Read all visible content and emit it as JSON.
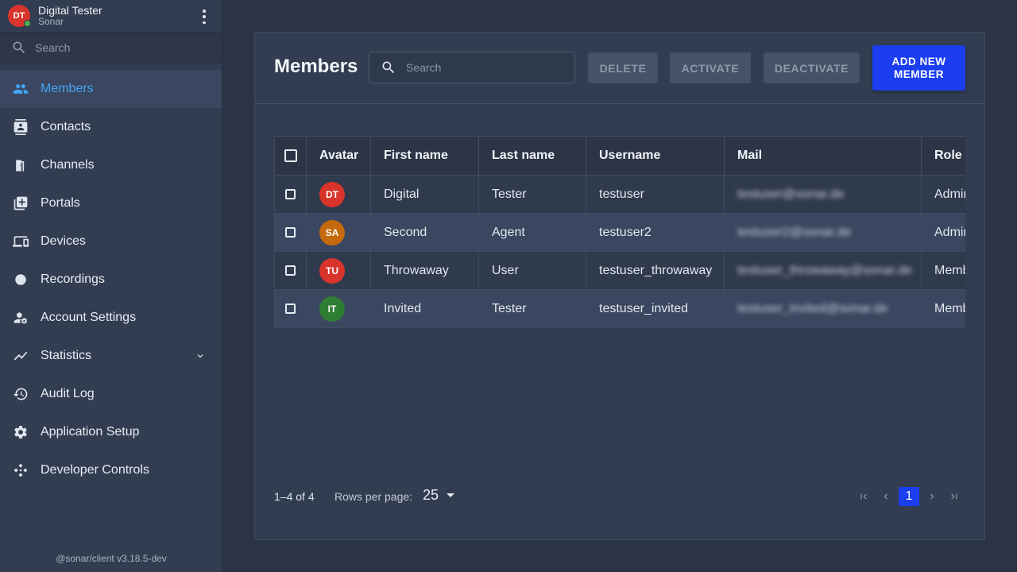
{
  "user": {
    "initials": "DT",
    "name": "Digital Tester",
    "org": "Sonar",
    "avatar_color": "#d9342b",
    "status_color": "#4caf50"
  },
  "sidebar": {
    "search_placeholder": "Search",
    "items": [
      {
        "label": "Members",
        "icon": "members-icon",
        "active": true
      },
      {
        "label": "Contacts",
        "icon": "contacts-icon"
      },
      {
        "label": "Channels",
        "icon": "channels-icon"
      },
      {
        "label": "Portals",
        "icon": "portals-icon"
      },
      {
        "label": "Devices",
        "icon": "devices-icon"
      },
      {
        "label": "Recordings",
        "icon": "recordings-icon"
      },
      {
        "label": "Account Settings",
        "icon": "account-settings-icon"
      },
      {
        "label": "Statistics",
        "icon": "statistics-icon",
        "expandable": true
      },
      {
        "label": "Audit Log",
        "icon": "audit-log-icon"
      },
      {
        "label": "Application Setup",
        "icon": "gear-icon"
      },
      {
        "label": "Developer Controls",
        "icon": "developer-controls-icon"
      }
    ],
    "version": "@sonar/client v3.18.5-dev"
  },
  "main": {
    "title": "Members",
    "search_placeholder": "Search",
    "buttons": {
      "delete": "Delete",
      "activate": "Activate",
      "deactivate": "Deactivate",
      "add_new_member": "Add new member"
    },
    "accent_color": "#1a3ef0",
    "columns": [
      "Avatar",
      "First name",
      "Last name",
      "Username",
      "Mail",
      "Role"
    ],
    "rows": [
      {
        "initials": "DT",
        "avatar_color": "#d9342b",
        "first": "Digital",
        "last": "Tester",
        "username": "testuser",
        "mail": "testuser@sonar.de",
        "role": "Admin"
      },
      {
        "initials": "SA",
        "avatar_color": "#c46a0c",
        "first": "Second",
        "last": "Agent",
        "username": "testuser2",
        "mail": "testuser2@sonar.de",
        "role": "Admin"
      },
      {
        "initials": "TU",
        "avatar_color": "#d9342b",
        "first": "Throwaway",
        "last": "User",
        "username": "testuser_throwaway",
        "mail": "testuser_throwaway@sonar.de",
        "role": "Member"
      },
      {
        "initials": "IT",
        "avatar_color": "#2e7d32",
        "first": "Invited",
        "last": "Tester",
        "username": "testuser_invited",
        "mail": "testuser_invited@sonar.de",
        "role": "Member"
      }
    ],
    "footer": {
      "count": "1–4 of 4",
      "rows_per_page_label": "Rows per page:",
      "rows_per_page": "25",
      "current_page": "1"
    }
  }
}
